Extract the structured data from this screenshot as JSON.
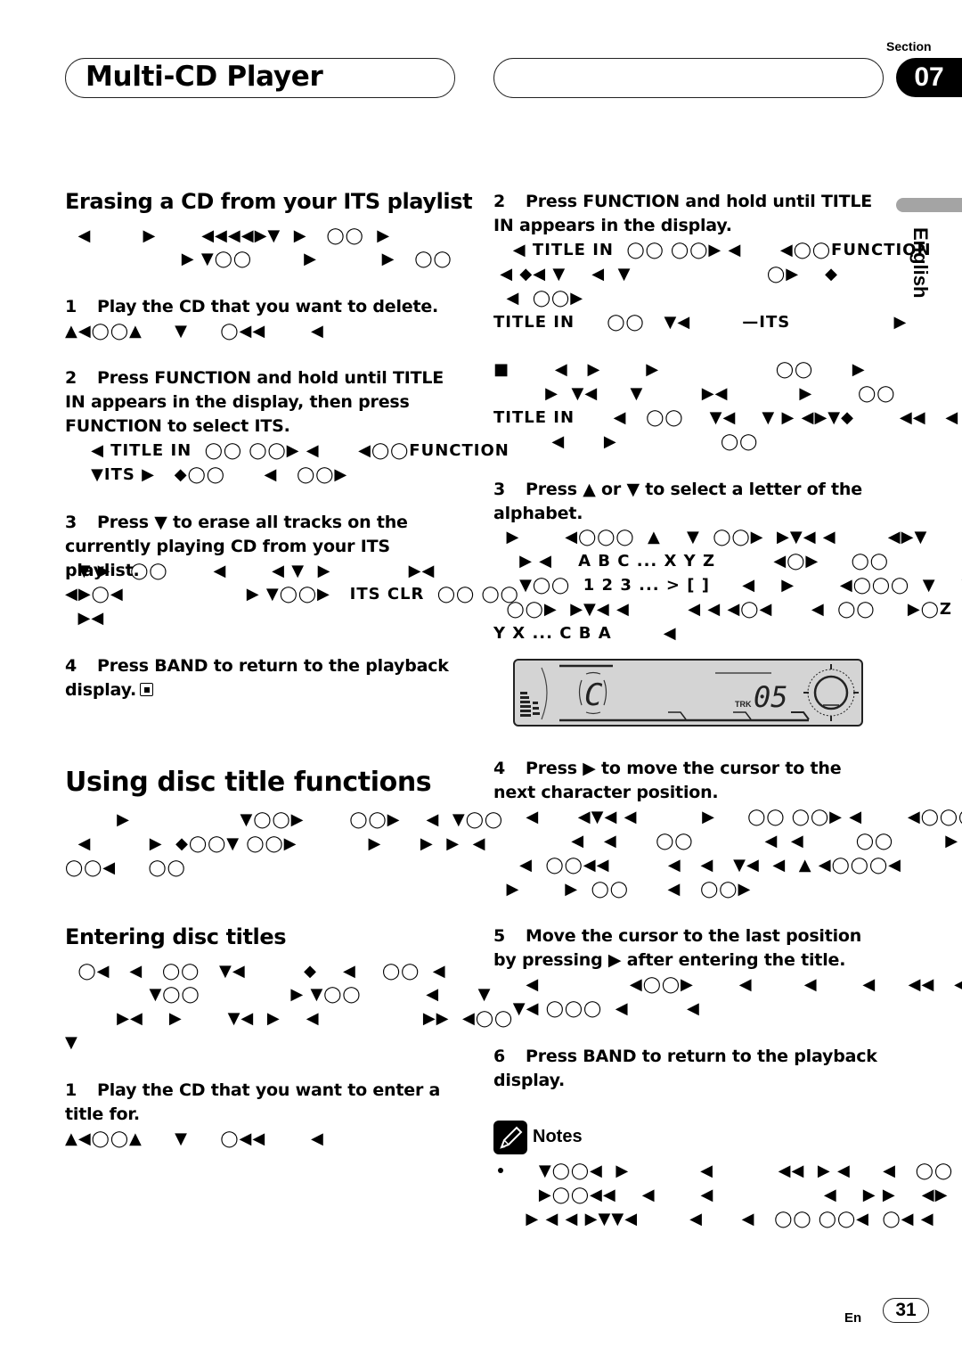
{
  "header": {
    "chapter_title": "Multi-CD Player",
    "section_label": "Section",
    "section_number": "07"
  },
  "sidebar": {
    "language": "English"
  },
  "left_column": {
    "erase_heading": "Erasing a CD from your ITS playlist",
    "erase_intro": [
      "  ◀        ▶       ◀◀◀◀▶▼  ▶   ◯◯  ▶",
      "                  ▶ ▼◯◯        ▶          ▶   ◯◯"
    ],
    "erase_steps": [
      {
        "num": "1",
        "text": "Play the CD that you want to delete.",
        "glyphs": [
          "▲◀◯◯▲     ▼     ◯◀◀       ◀"
        ]
      },
      {
        "num": "2",
        "text": "Press FUNCTION and hold until TITLE IN appears in the display, then press FUNCTION to select ITS.",
        "glyphs": [
          "    ◀ TITLE IN  ◯◯ ◯◯▶ ◀      ◀◯◯FUNCTION",
          "    ▼ITS ▶   ◆◯◯      ◀   ◯◯▶"
        ]
      },
      {
        "num": "3",
        "text": "Press ▼ to erase all tracks on the currently playing CD from your ITS playlist.",
        "glyphs": [
          "  ▼ ▶   ◯◯       ◀       ◀ ▼  ▶            ▶◀",
          "◀▶◯◀                   ▶ ▼◯◯▶   ITS CLR  ◯◯ ◯◯",
          "  ▶◀"
        ]
      },
      {
        "num": "4",
        "text": "Press BAND to return to the playback display.",
        "glyphs": []
      }
    ],
    "disc_title_heading": "Using disc title functions",
    "disc_title_intro": [
      "        ▶                 ▼◯◯▶       ◯◯▶    ◀  ▼◯◯",
      "  ◀         ▶  ◆◯◯▼ ◯◯▶           ▶      ▶  ▶  ◀",
      "◯◯◀     ◯◯"
    ],
    "entering_heading": "Entering disc titles",
    "entering_intro": [
      "  ◯◀   ◀   ◯◯   ▼◀         ◆    ◀    ◯◯  ◀",
      "             ▼◯◯              ▶ ▼◯◯          ◀      ▼",
      "        ▶◀    ▶       ▼◀  ▶    ◀                ▶▶  ◀◯◯",
      "▼"
    ],
    "entering_steps": [
      {
        "num": "1",
        "text": "Play the CD that you want to enter a title for.",
        "glyphs": [
          "▲◀◯◯▲     ▼     ◯◀◀       ◀"
        ]
      }
    ]
  },
  "right_column": {
    "steps": [
      {
        "num": "2",
        "text": "Press FUNCTION and hold until TITLE IN appears in the display.",
        "glyphs": [
          "   ◀ TITLE IN  ◯◯ ◯◯▶ ◀      ◀◯◯FUNCTION",
          " ◀ ◆◀ ▼    ◀  ▼                     ◯▶    ◆",
          "  ◀  ◯◯▶",
          "TITLE IN     ◯◯   ▼◀        —ITS                ▶"
        ],
        "extra_glyphs": [
          "■       ◀   ▶       ▶                  ◯◯      ▶",
          "        ▶  ▼◀     ▼         ▶◀           ▶       ◯◯",
          "TITLE IN      ◀   ◯◯    ▼◀    ▼ ▶ ◀▶▼◆       ◀◀   ◀",
          "         ◀      ▶                ◯◯"
        ]
      },
      {
        "num": "3",
        "text": "Press ▲ or ▼ to select a letter of the alphabet.",
        "glyphs": [
          "  ▶       ◀◯◯◯  ▲    ▼  ◯◯▶  ▶▼◀ ◀        ◀▶▼",
          "    ▶ ◀    A B C ... X Y Z         ◀◯▶     ◯◯",
          "    ▼◯◯  1 2 3 ... > [ ]     ◀    ▶       ◀◯◯◯  ▼    ▼",
          "  ◯◯▶  ▶▼◀ ◀         ◀ ◀ ◀◯◀      ◀  ◯◯     ▶◯Z",
          "Y X ... C B A        ◀"
        ]
      },
      {
        "num": "4",
        "text": "Press ▶ to move the cursor to the next character position.",
        "glyphs": [
          "     ◀      ◀▼◀ ◀          ▶     ◯◯ ◯◯▶ ◀       ◀◯◯◯▶",
          "            ◀   ◀      ◯◯           ◀  ◀        ◯◯        ▶",
          "    ◀  ◯◯◀◀         ◀   ◀   ▼◀  ◀  ▲ ◀◯◯◯◀               ◀",
          "  ▶       ▶  ◯◯      ◀   ◯◯▶"
        ]
      },
      {
        "num": "5",
        "text": "Move the cursor to the last position by pressing ▶ after entering the title.",
        "glyphs": [
          "     ◀              ◀◯◯▶       ◀        ◀       ◀     ◀◀   ◀◀",
          "   ▼◀ ◯◯◯  ◀         ◀"
        ]
      },
      {
        "num": "6",
        "text": "Press BAND to return to the playback display.",
        "glyphs": []
      }
    ],
    "lcd": {
      "character": "C",
      "track_label": "TRK",
      "track_number": "05"
    },
    "notes": {
      "label": "Notes",
      "bullets": [
        [
          "       ▼◯◯◀  ▶           ◀          ◀◀  ▶ ◀     ◀   ◯◯",
          "       ▶◯◯◀◀    ◀       ◀                 ◀    ▶ ▶    ◀▶",
          "     ▶ ◀ ◀ ▶▼▼◀        ◀      ◀   ◯◯ ◯◯◀  ◯◀ ◀"
        ]
      ]
    }
  },
  "footer": {
    "lang_code": "En",
    "page_number": "31"
  }
}
